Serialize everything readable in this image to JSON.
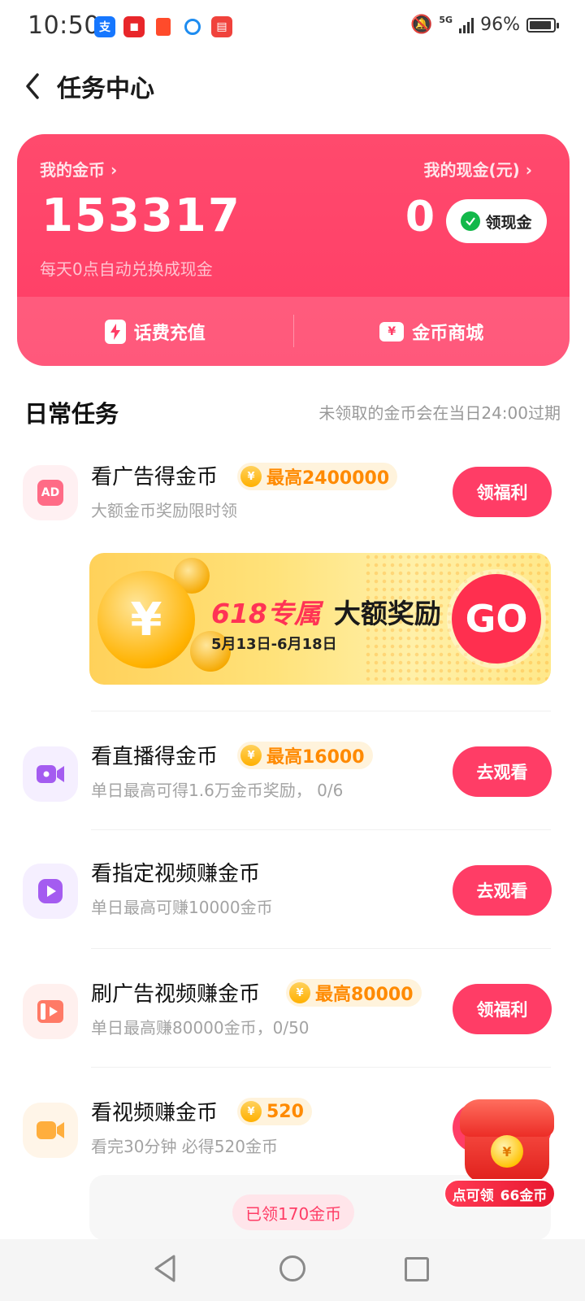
{
  "status_bar": {
    "time": "10:50",
    "network": "5G",
    "battery": "96%"
  },
  "header": {
    "title": "任务中心"
  },
  "wallet": {
    "coins_label": "我的金币",
    "coins_value": "153317",
    "coins_note": "每天0点自动兑换成现金",
    "cash_label": "我的现金(元)",
    "cash_value": "0",
    "cash_button": "领现金",
    "actions": [
      {
        "label": "话费充值",
        "icon": "lightning-icon"
      },
      {
        "label": "金币商城",
        "icon": "ticket-icon"
      }
    ]
  },
  "daily": {
    "title": "日常任务",
    "note": "未领取的金币会在当日24:00过期"
  },
  "tasks": [
    {
      "title": "看广告得金币",
      "badge": "最高2400000",
      "subtitle": "大额金币奖励限时领",
      "button": "领福利",
      "icon": "ad-icon"
    },
    {
      "title": "看直播得金币",
      "badge": "最高16000",
      "subtitle": "单日最高可得1.6万金币奖励， 0/6",
      "button": "去观看",
      "icon": "live-camera-icon"
    },
    {
      "title": "看指定视频赚金币",
      "badge": "",
      "subtitle": "单日最高可赚10000金币",
      "button": "去观看",
      "icon": "play-icon"
    },
    {
      "title": "刷广告视频赚金币",
      "badge": "最高80000",
      "subtitle": "单日最高赚80000金币，0/50",
      "button": "领福利",
      "icon": "video-ad-icon"
    },
    {
      "title": "看视频赚金币",
      "badge": "520",
      "subtitle": "看完30分钟 必得520金币",
      "button": "",
      "icon": "video-camera-icon"
    }
  ],
  "banner": {
    "highlight": "618专属",
    "headline": "大额奖励",
    "dates": "5月13日-6月18日",
    "cta": "GO"
  },
  "tracker": {
    "claimed": "已领170金币"
  },
  "floating_reward": {
    "label": "点可领",
    "amount": "66金币"
  },
  "colors": {
    "brand": "#ff3d66",
    "coin": "#ff8a00",
    "muted": "#a3a3a3"
  }
}
